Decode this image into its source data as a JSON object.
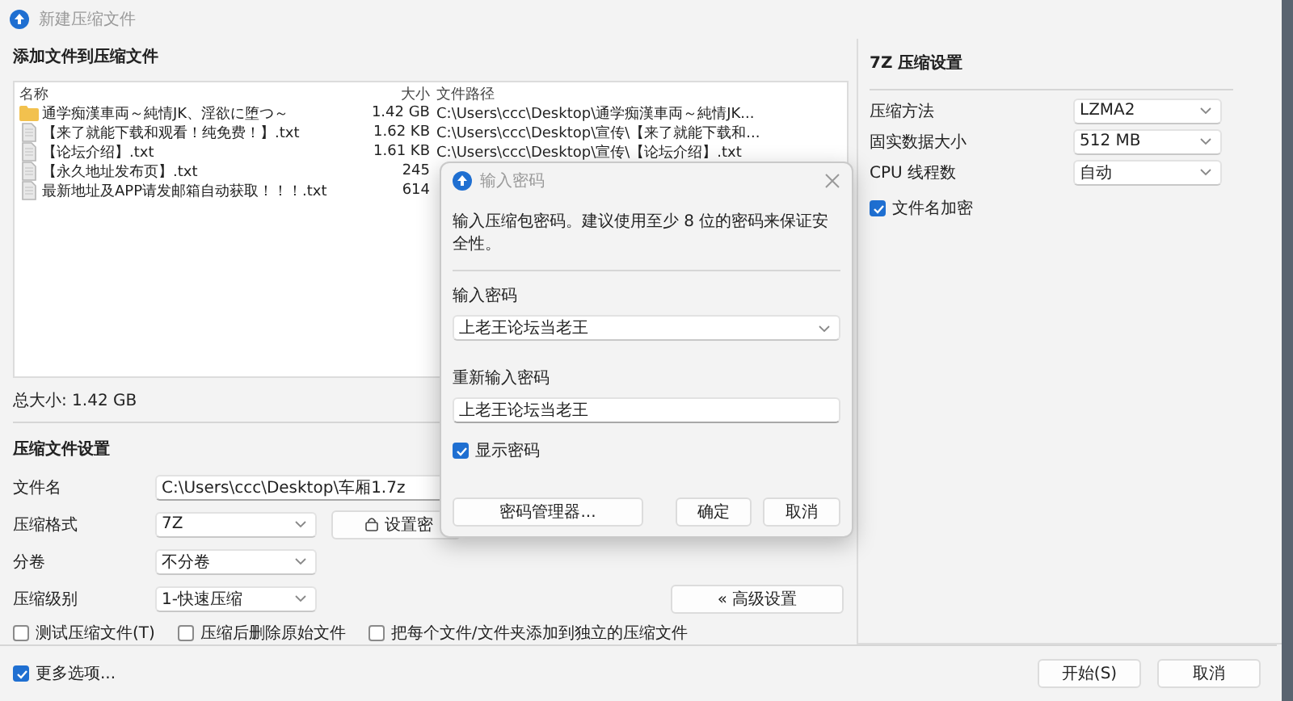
{
  "window": {
    "title": "新建压缩文件"
  },
  "files": {
    "heading": "添加文件到压缩文件",
    "columns": [
      "名称",
      "大小",
      "文件路径"
    ],
    "rows": [
      {
        "kind": "folder",
        "name": "通学痴漢車両～純情JK、淫欲に堕つ～",
        "size": "1.42 GB",
        "path": "C:\\Users\\ccc\\Desktop\\通学痴漢車両～純情JK..."
      },
      {
        "kind": "file",
        "name": "【来了就能下载和观看！纯免费！】.txt",
        "size": "1.62 KB",
        "path": "C:\\Users\\ccc\\Desktop\\宣传\\【来了就能下载和..."
      },
      {
        "kind": "file",
        "name": "【论坛介绍】.txt",
        "size": "1.61 KB",
        "path": "C:\\Users\\ccc\\Desktop\\宣传\\【论坛介绍】.txt"
      },
      {
        "kind": "file",
        "name": "【永久地址发布页】.txt",
        "size": "245"
      },
      {
        "kind": "file",
        "name": "最新地址及APP请发邮箱自动获取！！！.txt",
        "size": "614"
      }
    ],
    "total": "总大小: 1.42 GB"
  },
  "settings": {
    "heading": "压缩文件设置",
    "filename": {
      "label": "文件名",
      "value": "C:\\Users\\ccc\\Desktop\\车厢1.7z"
    },
    "format": {
      "label": "压缩格式",
      "value": "7Z"
    },
    "password_button": "设置密",
    "split": {
      "label": "分卷",
      "value": "不分卷"
    },
    "level": {
      "label": "压缩级别",
      "value": "1-快速压缩"
    },
    "advanced_button": "« 高级设置",
    "options": [
      {
        "label": "测试压缩文件(T)",
        "checked": false
      },
      {
        "label": "压缩后删除原始文件",
        "checked": false
      },
      {
        "label": "把每个文件/文件夹添加到独立的压缩文件",
        "checked": false
      }
    ]
  },
  "seven_zip": {
    "heading": "7Z 压缩设置",
    "fields": [
      {
        "label": "压缩方法",
        "value": "LZMA2"
      },
      {
        "label": "固实数据大小",
        "value": "512 MB"
      },
      {
        "label": "CPU 线程数",
        "value": "自动"
      }
    ],
    "encrypt_names": {
      "label": "文件名加密",
      "checked": true
    }
  },
  "more_options": {
    "label": "更多选项...",
    "checked": true
  },
  "buttons": [
    "开始(S)",
    "取消"
  ],
  "password_dialog": {
    "title": "输入密码",
    "message": "输入压缩包密码。建议使用至少 8 位的密码来保证安全性。",
    "password": {
      "label": "输入密码",
      "value": "上老王论坛当老王"
    },
    "confirm": {
      "label": "重新输入密码",
      "value": "上老王论坛当老王"
    },
    "show_password": {
      "label": "显示密码",
      "checked": true
    },
    "buttons": [
      "密码管理器...",
      "确定",
      "取消"
    ]
  }
}
